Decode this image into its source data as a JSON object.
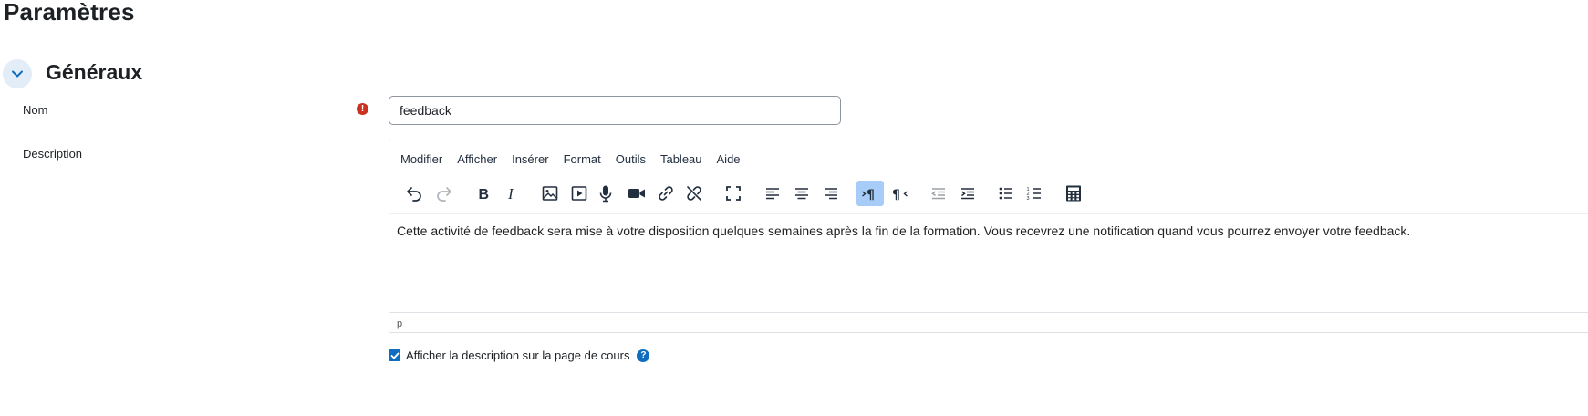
{
  "page": {
    "title": "Paramètres"
  },
  "section": {
    "title": "Généraux",
    "toggle_icon": "chevron-down-icon"
  },
  "fields": {
    "name": {
      "label": "Nom",
      "value": "feedback",
      "required_icon": "!"
    },
    "description": {
      "label": "Description"
    }
  },
  "editor": {
    "menu": [
      "Modifier",
      "Afficher",
      "Insérer",
      "Format",
      "Outils",
      "Tableau",
      "Aide"
    ],
    "toolbar_icons": [
      "undo-icon",
      "redo-icon",
      "bold-icon",
      "italic-icon",
      "image-icon",
      "media-icon",
      "record-audio-icon",
      "record-video-icon",
      "link-icon",
      "unlink-icon",
      "fullscreen-icon",
      "align-left-icon",
      "align-center-icon",
      "align-right-icon",
      "ltr-icon",
      "rtl-icon",
      "outdent-icon",
      "indent-icon",
      "bullet-list-icon",
      "numbered-list-icon",
      "equation-editor-icon"
    ],
    "content": "Cette activité de feedback sera mise à votre disposition quelques semaines après la fin de la formation. Vous recevrez une notification quand vous pourrez envoyer votre feedback.",
    "status_path": "p"
  },
  "show_description": {
    "label": "Afficher la description sur la page de cours",
    "checked": true,
    "help_icon": "?"
  },
  "colors": {
    "accent": "#0f6cbf",
    "required": "#ca3120",
    "toggle_bg": "#e3edf7",
    "active_button": "#a6ccf7"
  }
}
